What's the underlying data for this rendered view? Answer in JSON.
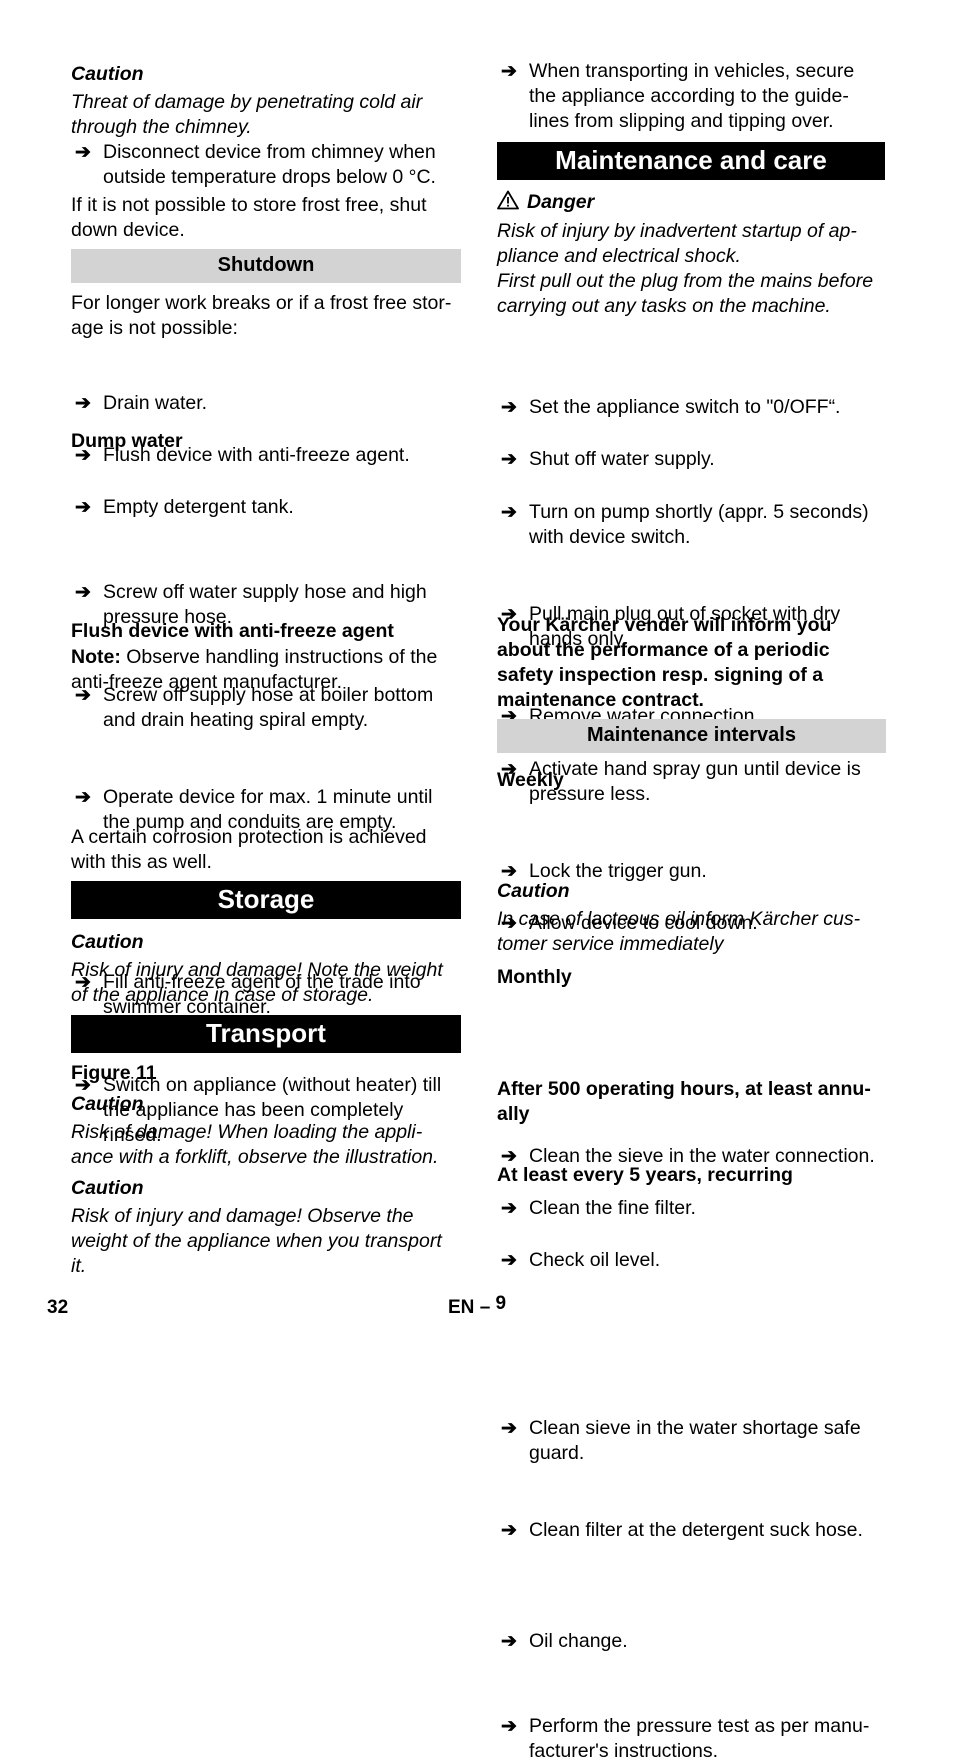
{
  "left": {
    "caution1_heading": "Caution",
    "caution1_text_l1": "Threat of damage by penetrating cold air",
    "caution1_text_l2": "through the chimney.",
    "chimney_step_l1": "Disconnect device from chimney when",
    "chimney_step_l2": "outside temperature drops below 0 °C.",
    "frost_para_l1": "If it is not possible to store frost free, shut",
    "frost_para_l2": "down device.",
    "shutdown_heading": "Shutdown",
    "shutdown_intro_l1": "For longer work breaks or if a frost free stor-",
    "shutdown_intro_l2": "age is not possible:",
    "shutdown_steps": [
      "Drain water.",
      "Flush device with anti-freeze agent.",
      "Empty detergent tank."
    ],
    "dump_heading": "Dump water",
    "dump_steps": [
      {
        "l1": "Screw off water supply hose and high",
        "l2": "pressure hose."
      },
      {
        "l1": "Screw off supply hose at boiler bottom",
        "l2": "and drain heating spiral empty."
      },
      {
        "l1": "Operate device for max. 1 minute until",
        "l2": "the pump and conduits are empty."
      }
    ],
    "flush_heading": "Flush device with anti-freeze agent",
    "note_label": "Note:",
    "note_text_l1": " Observe handling instructions of the",
    "note_text_l2": "anti-freeze agent manufacturer.",
    "flush_steps": [
      {
        "l1": "Fill anti-freeze agent of the trade into",
        "l2": "swimmer container.",
        "l3": ""
      },
      {
        "l1": "Switch on appliance (without heater) till",
        "l2": "the appliance has been completely",
        "l3": "rinsed."
      }
    ],
    "corrosion_l1": "A certain corrosion protection is achieved",
    "corrosion_l2": "with this as well.",
    "storage_heading": "Storage",
    "storage_caution_heading": "Caution",
    "storage_caution_l1": "Risk of injury and damage! Note the weight",
    "storage_caution_l2": "of the appliance in case of storage.",
    "transport_heading": "Transport",
    "figure_ref": "Figure 11",
    "transport_caution1_heading": "Caution",
    "transport_caution1_l1": "Risk of damage! When loading the appli-",
    "transport_caution1_l2": "ance with a forklift, observe the illustration.",
    "transport_caution2_heading": "Caution",
    "transport_caution2_l1": "Risk of injury and damage! Observe the",
    "transport_caution2_l2": "weight of the appliance when you transport",
    "transport_caution2_l3": "it."
  },
  "right": {
    "vehicle_step_l1": "When transporting in vehicles, secure",
    "vehicle_step_l2": "the appliance according to the guide-",
    "vehicle_step_l3": "lines from slipping and tipping over.",
    "maintenance_heading": "Maintenance and care",
    "danger_icon": "warning-triangle-icon",
    "danger_heading": "Danger",
    "danger_l1": "Risk of injury by inadvertent startup of ap-",
    "danger_l2": "pliance and electrical shock.",
    "danger_l3": "First pull out the plug from the mains before",
    "danger_l4": "carrying out any tasks on the machine.",
    "maint_steps": [
      {
        "l1": "Set the appliance switch to \"0/OFF“.",
        "l2": ""
      },
      {
        "l1": "Shut off water supply.",
        "l2": ""
      },
      {
        "l1": "Turn on pump shortly (appr. 5 seconds)",
        "l2": "with device switch."
      },
      {
        "l1": "Pull main plug out of socket with dry",
        "l2": "hands only."
      },
      {
        "l1": "Remove water connection.",
        "l2": ""
      },
      {
        "l1": "Activate hand spray gun until device is",
        "l2": "pressure less."
      },
      {
        "l1": "Lock the trigger gun.",
        "l2": ""
      },
      {
        "l1": "Allow device to cool down.",
        "l2": ""
      }
    ],
    "vendor_l1": "Your Kärcher vender will inform you",
    "vendor_l2": "about the performance of a periodic",
    "vendor_l3": "safety inspection resp. signing of a",
    "vendor_l4": "maintenance contract.",
    "intervals_heading": "Maintenance intervals",
    "weekly_heading": "Weekly",
    "weekly_steps": [
      "Clean the sieve in the water connection.",
      "Clean the fine filter.",
      "Check oil level."
    ],
    "weekly_caution_heading": "Caution",
    "weekly_caution_l1": "In case of lacteous oil inform Kärcher cus-",
    "weekly_caution_l2": "tomer service immediately",
    "monthly_heading": "Monthly",
    "monthly_steps": [
      {
        "l1": "Clean sieve in the water shortage safe",
        "l2": "guard."
      },
      {
        "l1": "Clean filter at the detergent suck hose.",
        "l2": ""
      }
    ],
    "annual_heading_l1": "After 500 operating hours, at least annu-",
    "annual_heading_l2": "ally",
    "annual_steps": [
      "Oil change."
    ],
    "five_year_heading": "At least every 5 years, recurring",
    "five_year_step_l1": "Perform the pressure test as per manu-",
    "five_year_step_l2": "facturer's instructions."
  },
  "footer": {
    "page_number": "32",
    "lang": "EN",
    "dash": "–",
    "section_page": "9"
  },
  "bullet_glyph": "➔"
}
